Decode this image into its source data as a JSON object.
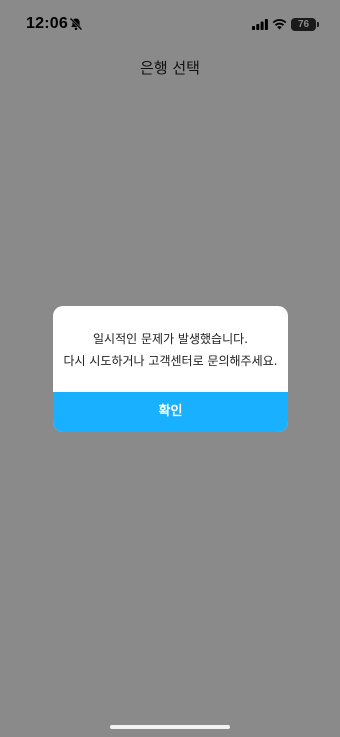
{
  "status_bar": {
    "time": "12:06",
    "battery": "76",
    "icons": [
      "bell-slash-icon",
      "signal-icon",
      "wifi-icon",
      "battery-icon"
    ]
  },
  "header": {
    "title": "은행 선택"
  },
  "dialog": {
    "line1": "일시적인 문제가 발생했습니다.",
    "line2": "다시 시도하거나 고객센터로 문의해주세요.",
    "confirm_label": "확인"
  },
  "colors": {
    "overlay": "#8a8a8a",
    "accent": "#18b0ff",
    "dialog_bg": "#ffffff"
  }
}
